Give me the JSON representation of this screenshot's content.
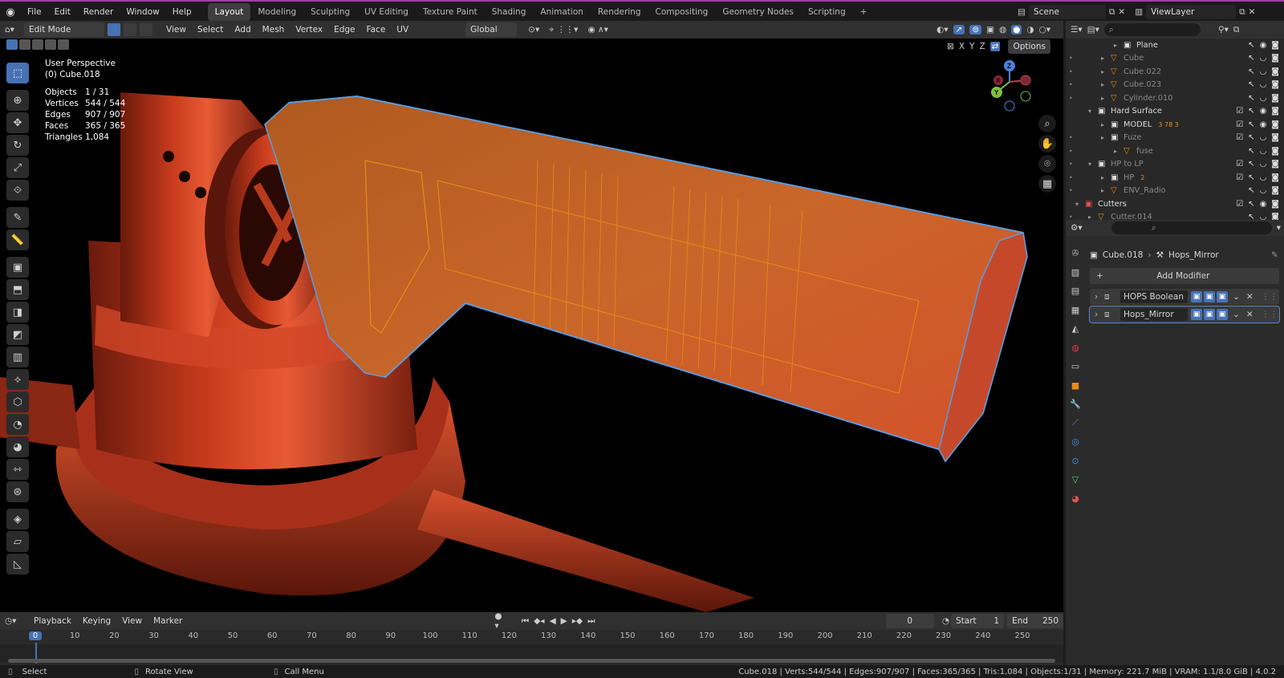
{
  "menubar": {
    "items": [
      "File",
      "Edit",
      "Render",
      "Window",
      "Help"
    ],
    "workspaces": [
      "Layout",
      "Modeling",
      "Sculpting",
      "UV Editing",
      "Texture Paint",
      "Shading",
      "Animation",
      "Rendering",
      "Compositing",
      "Geometry Nodes",
      "Scripting"
    ],
    "active_workspace": "Layout",
    "add_tab": "+",
    "scene": "Scene",
    "view_layer": "ViewLayer"
  },
  "header": {
    "mode": "Edit Mode",
    "menus": [
      "View",
      "Select",
      "Add",
      "Mesh",
      "Vertex",
      "Edge",
      "Face",
      "UV"
    ],
    "orientation": "Global",
    "options": "Options",
    "axes": [
      "X",
      "Y",
      "Z"
    ]
  },
  "viewport": {
    "view_name": "User Perspective",
    "object_name": "(0) Cube.018",
    "stats": [
      {
        "k": "Objects",
        "v": "1 / 31"
      },
      {
        "k": "Vertices",
        "v": "544 / 544"
      },
      {
        "k": "Edges",
        "v": "907 / 907"
      },
      {
        "k": "Faces",
        "v": "365 / 365"
      },
      {
        "k": "Triangles",
        "v": "1,084"
      }
    ],
    "gizmo": {
      "x": "X",
      "y": "Y",
      "z": "Z"
    }
  },
  "tools": [
    "select-box",
    "cursor",
    "move",
    "rotate",
    "scale",
    "transform",
    "annotate",
    "measure",
    "add-cube",
    "extrude",
    "inset",
    "bevel",
    "loop-cut",
    "knife",
    "poly-build",
    "spin",
    "smooth",
    "edge-slide",
    "shrink",
    "shear",
    "rip",
    "shape"
  ],
  "outliner": {
    "rows": [
      {
        "name": "Plane",
        "indent": 3,
        "icon": "collection",
        "dim": false
      },
      {
        "name": "Cube",
        "indent": 2,
        "icon": "mesh",
        "dim": true
      },
      {
        "name": "Cube.022",
        "indent": 2,
        "icon": "mesh",
        "dim": true
      },
      {
        "name": "Cube.023",
        "indent": 2,
        "icon": "mesh",
        "dim": true
      },
      {
        "name": "Cylinder.010",
        "indent": 2,
        "icon": "mesh",
        "dim": true
      },
      {
        "name": "Hard Surface",
        "indent": 1,
        "icon": "collection",
        "dim": false
      },
      {
        "name": "MODEL",
        "indent": 2,
        "icon": "collection",
        "dim": false,
        "badge": "3 78 3"
      },
      {
        "name": "Fuze",
        "indent": 2,
        "icon": "collection",
        "dim": true
      },
      {
        "name": "fuse",
        "indent": 3,
        "icon": "mesh",
        "dim": true
      },
      {
        "name": "HP to LP",
        "indent": 1,
        "icon": "collection",
        "dim": true
      },
      {
        "name": "HP",
        "indent": 2,
        "icon": "collection",
        "dim": true,
        "badge": "2"
      },
      {
        "name": "ENV_Radio",
        "indent": 2,
        "icon": "mesh",
        "dim": true
      },
      {
        "name": "Cutters",
        "indent": 0,
        "icon": "collection-red",
        "dim": false
      },
      {
        "name": "Cutter.014",
        "indent": 1,
        "icon": "mesh",
        "dim": true
      }
    ]
  },
  "properties": {
    "object": "Cube.018",
    "modifier_path": "Hops_Mirror",
    "add_modifier": "Add Modifier",
    "modifiers": [
      {
        "name": "HOPS Boolean",
        "selected": false
      },
      {
        "name": "Hops_Mirror",
        "selected": true
      }
    ]
  },
  "timeline": {
    "menus": [
      "Playback",
      "Keying",
      "View",
      "Marker"
    ],
    "current_frame": "0",
    "start_label": "Start",
    "start": "1",
    "end_label": "End",
    "end": "250",
    "ticks": [
      "0",
      "10",
      "20",
      "30",
      "40",
      "50",
      "60",
      "70",
      "80",
      "90",
      "100",
      "110",
      "120",
      "130",
      "140",
      "150",
      "160",
      "170",
      "180",
      "190",
      "200",
      "210",
      "220",
      "230",
      "240",
      "250"
    ]
  },
  "statusbar": {
    "select": "Select",
    "rotate": "Rotate View",
    "menu": "Call Menu",
    "info": "Cube.018 | Verts:544/544 | Edges:907/907 | Faces:365/365 | Tris:1,084 | Objects:1/31 | Memory: 221.7 MiB | VRAM: 1.1/8.0 GiB | 4.0.2"
  },
  "colors": {
    "accent": "#4772b3",
    "selection_orange": "#e98b16",
    "edge_blue": "#5b9bdd",
    "model_red": "#c33a1a"
  }
}
